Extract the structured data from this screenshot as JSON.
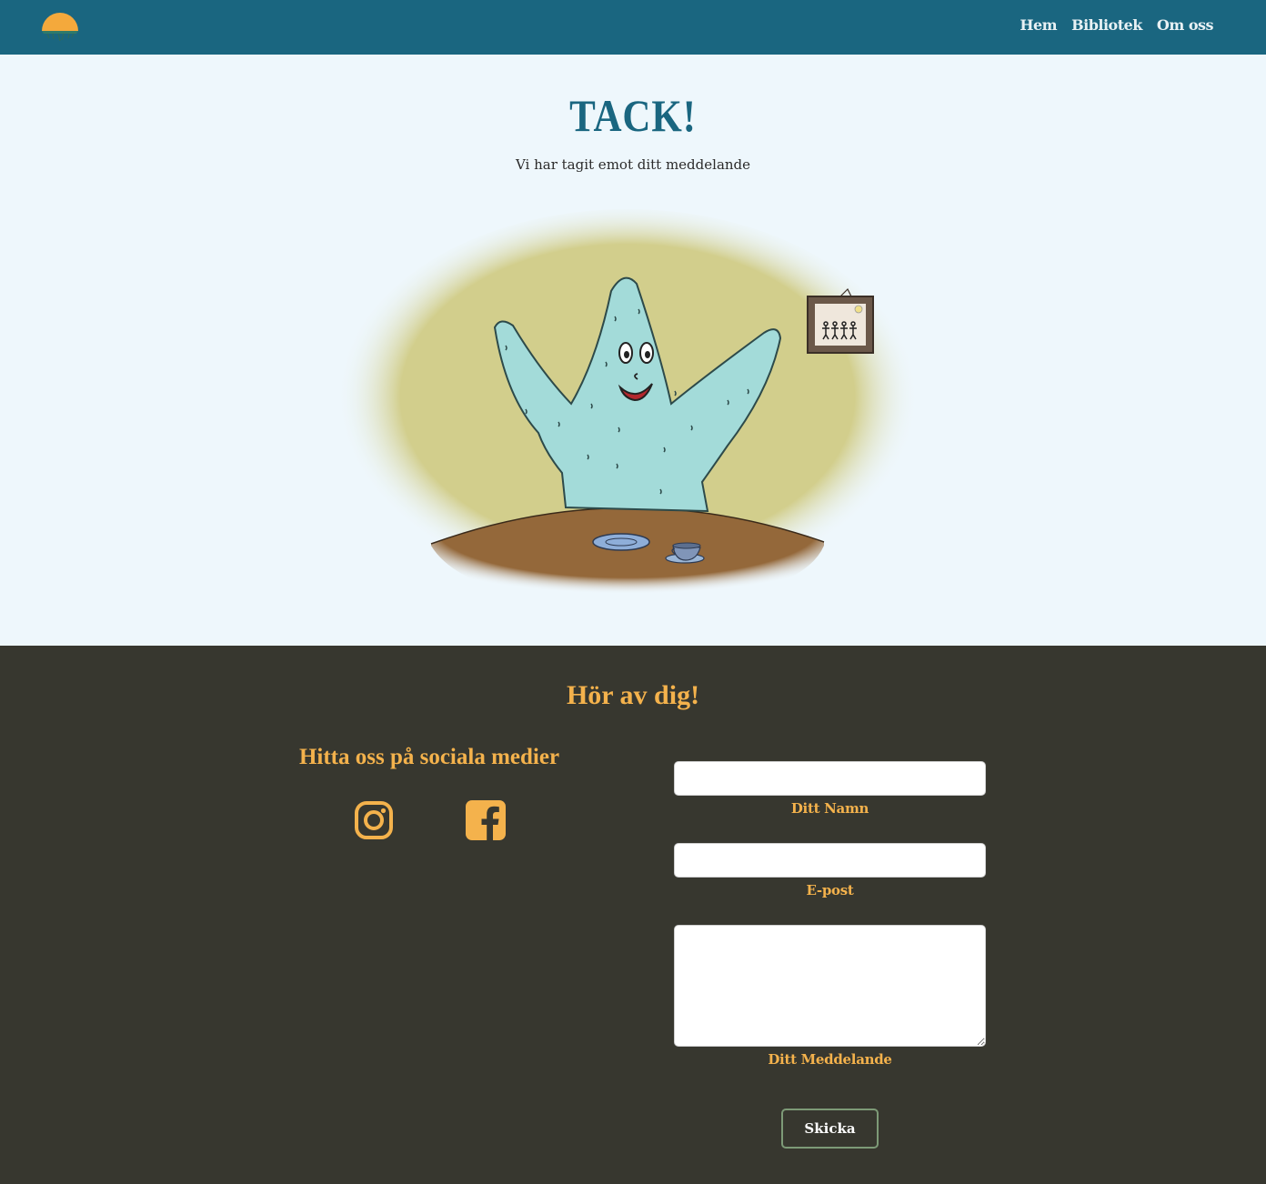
{
  "nav": {
    "logo_icon": "sunset-logo-icon",
    "links": [
      "Hem",
      "Bibliotek",
      "Om oss"
    ]
  },
  "hero": {
    "title": "TACK!",
    "subtitle": "Vi har tagit emot ditt meddelande",
    "illustration": "starfish-character-at-table"
  },
  "footer": {
    "title": "Hör av dig!",
    "social": {
      "title": "Hitta oss på sociala medier",
      "icons": [
        "instagram-icon",
        "facebook-icon"
      ]
    },
    "form": {
      "name_label": "Ditt Namn",
      "email_label": "E-post",
      "message_label": "Ditt Meddelande",
      "name_value": "",
      "email_value": "",
      "message_value": "",
      "submit_label": "Skicka"
    }
  },
  "colors": {
    "nav_bg": "#1a6680",
    "hero_bg": "#eef7fc",
    "footer_bg": "#37372f",
    "accent": "#f4b24c",
    "title_blue": "#1a6680"
  }
}
